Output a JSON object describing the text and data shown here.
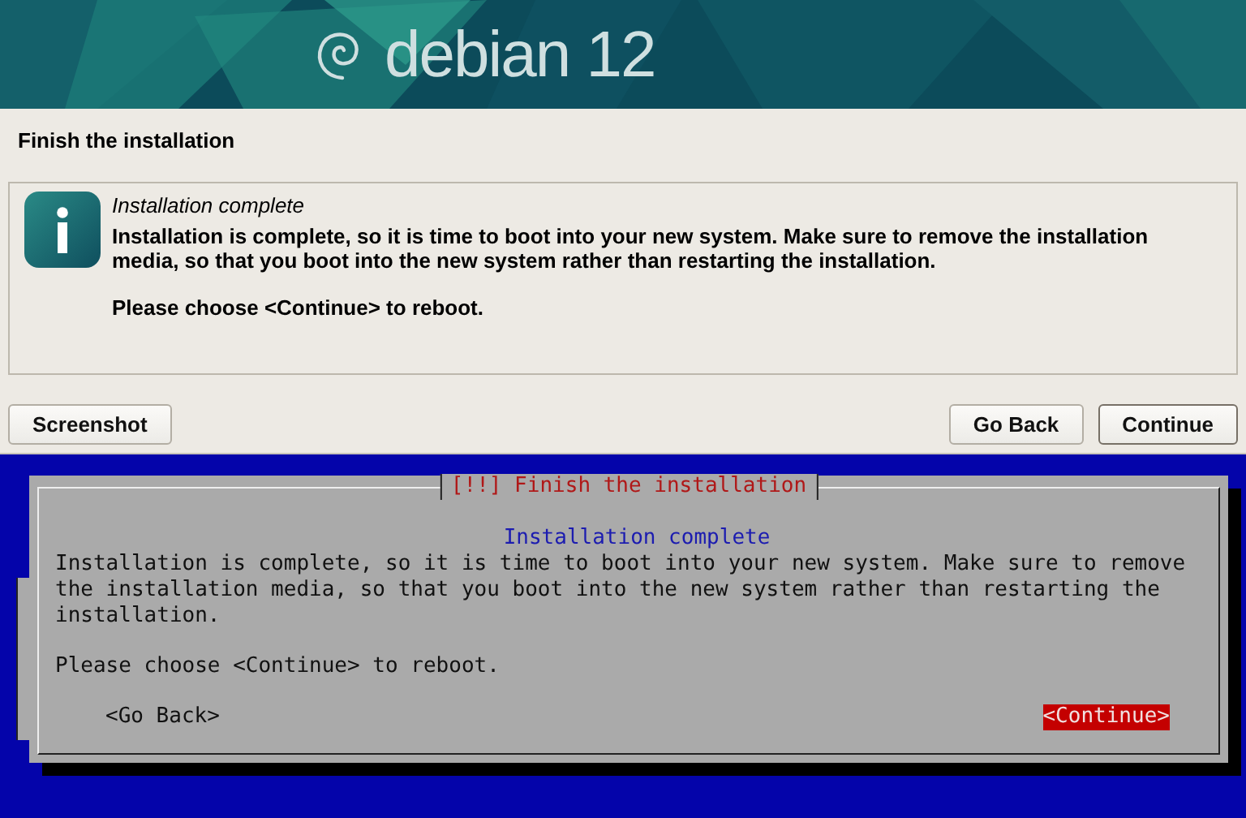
{
  "banner": {
    "logo_text": "debian 12"
  },
  "gui": {
    "title": "Finish the installation",
    "heading": "Installation complete",
    "body": "Installation is complete, so it is time to boot into your new system. Make sure to remove the installation media, so that you boot into the new system rather than restarting the installation.",
    "prompt": "Please choose <Continue> to reboot.",
    "buttons": [
      {
        "label": "Screenshot",
        "selected": false
      },
      {
        "label": "Go Back",
        "selected": false
      },
      {
        "label": "Continue",
        "selected": true
      }
    ]
  },
  "text_ui": {
    "title": "[!!] Finish the installation",
    "heading": "Installation complete",
    "body": "Installation is complete, so it is time to boot into your new system. Make sure to remove the installation media, so that you boot into the new system rather than restarting the installation.",
    "prompt": "Please choose <Continue> to reboot.",
    "buttons": [
      {
        "label": "<Go Back>",
        "selected": false
      },
      {
        "label": "<Continue>",
        "selected": true
      }
    ]
  }
}
